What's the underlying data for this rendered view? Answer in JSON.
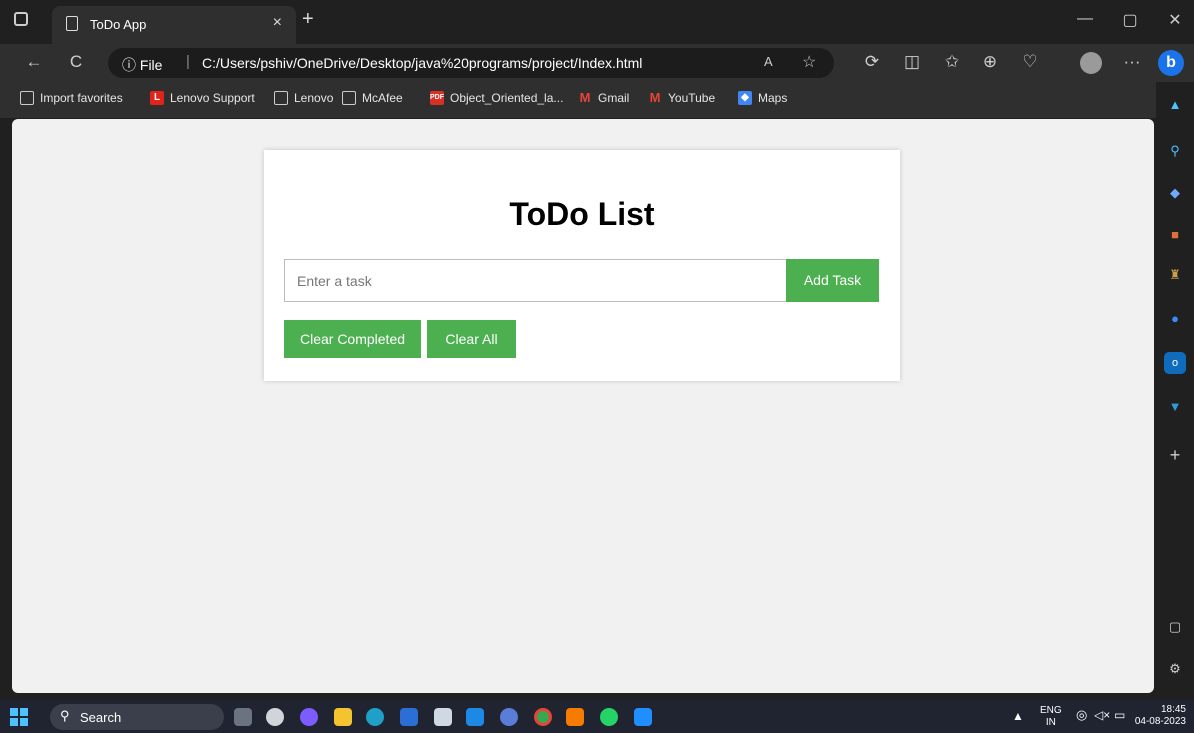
{
  "window": {
    "tab_title": "ToDo App",
    "tab_close": "×",
    "new_tab": "+",
    "minimize": "—",
    "maximize": "▢",
    "close": "✕"
  },
  "nav": {
    "back": "←",
    "refresh": "C",
    "info_label": "ⓘ File",
    "separator": "|",
    "url": "C:/Users/pshiv/OneDrive/Desktop/java%20programs/project/Index.html",
    "more": "···"
  },
  "favorites": [
    {
      "label": "Import favorites",
      "icon": "import-icon",
      "color": "#cccccc"
    },
    {
      "label": "Lenovo Support",
      "icon": "lenovo-icon",
      "color": "#e2231a"
    },
    {
      "label": "Lenovo",
      "icon": "page-icon",
      "color": "#cccccc"
    },
    {
      "label": "McAfee",
      "icon": "page-icon",
      "color": "#cccccc"
    },
    {
      "label": "Object_Oriented_la...",
      "icon": "pdf-icon",
      "color": "#d93025"
    },
    {
      "label": "Gmail",
      "icon": "gmail-icon",
      "color": "#ea4335"
    },
    {
      "label": "YouTube",
      "icon": "gmail-icon",
      "color": "#ea4335"
    },
    {
      "label": "Maps",
      "icon": "maps-icon",
      "color": "#4285f4"
    }
  ],
  "todo": {
    "title": "ToDo List",
    "input_placeholder": "Enter a task",
    "add_button": "Add Task",
    "clear_completed": "Clear Completed",
    "clear_all": "Clear All",
    "accent_color": "#4caf50"
  },
  "taskbar": {
    "search_label": "Search",
    "lang_top": "ENG",
    "lang_bottom": "IN",
    "time": "18:45",
    "date": "04-08-2023"
  }
}
